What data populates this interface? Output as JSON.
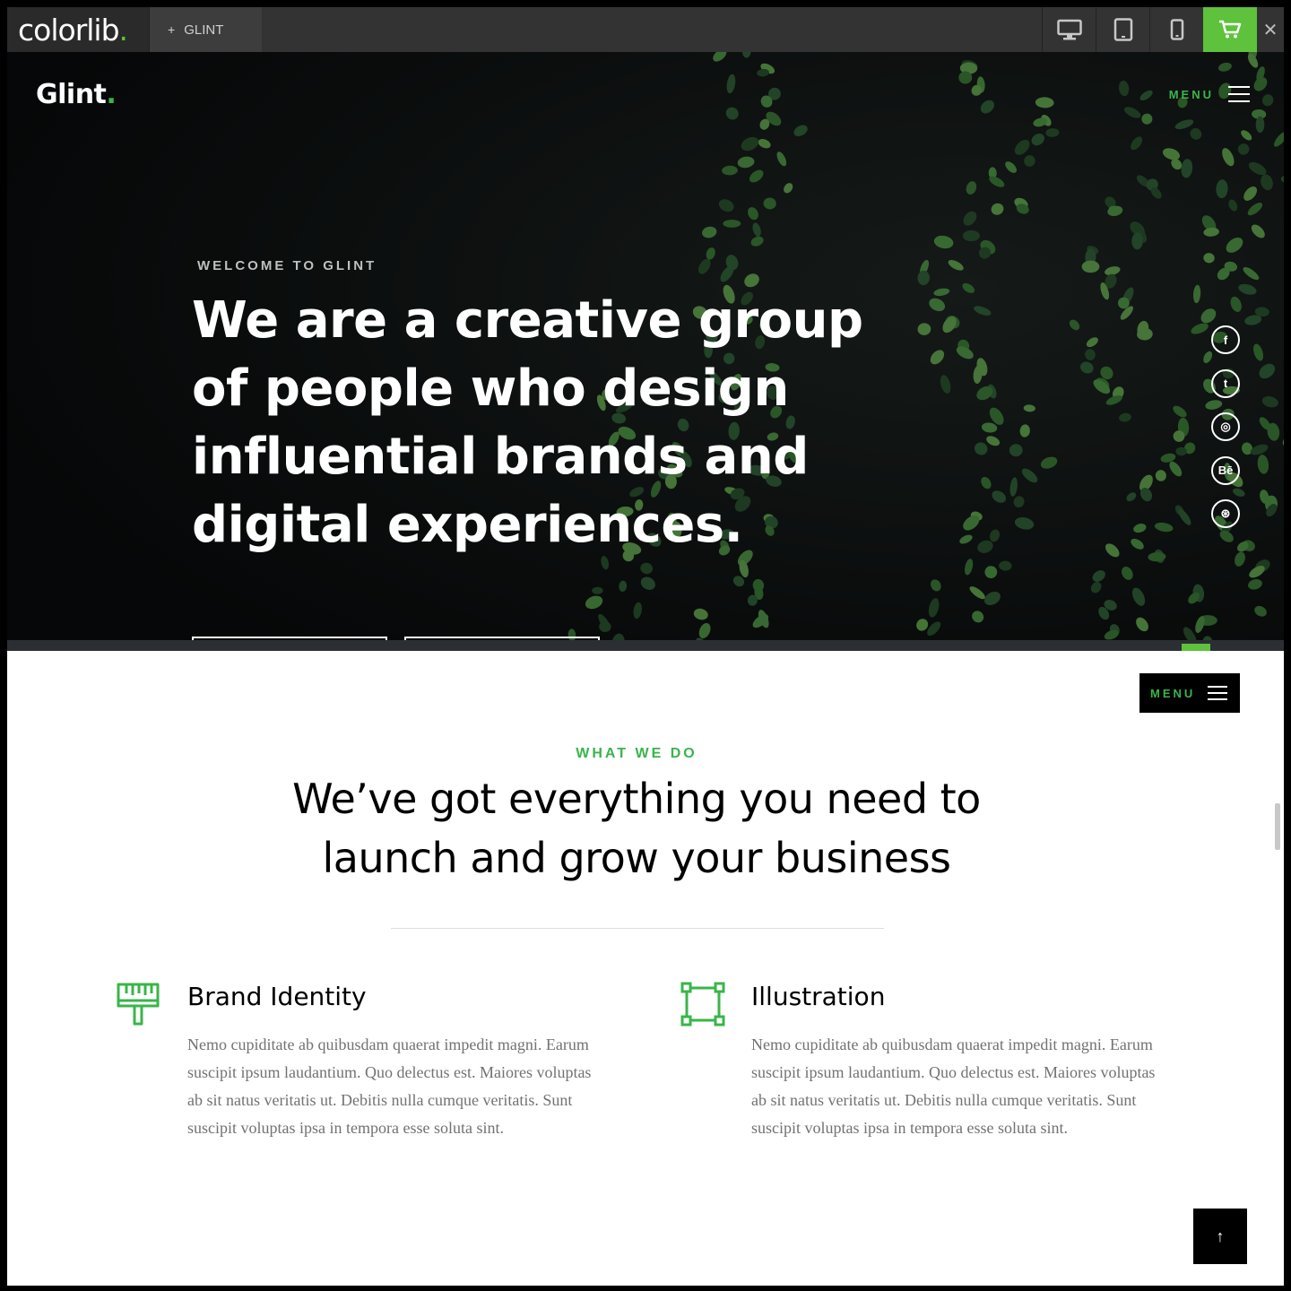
{
  "topbar": {
    "brand": "colorlib",
    "brand_dot": ".",
    "template_tab": "GLINT",
    "template_plus": "+",
    "devices": [
      "desktop-icon",
      "tablet-icon",
      "mobile-icon"
    ],
    "cart_icon": "cart-icon",
    "close_icon": "close-icon",
    "close_glyph": "✕",
    "accent": "#5ec23c"
  },
  "hero": {
    "logo": "Glint",
    "logo_dot": ".",
    "menu_label": "MENU",
    "welcome": "WELCOME TO GLINT",
    "headline_lines": [
      "We are a creative group",
      "of people who design",
      "influential brands and",
      "digital experiences."
    ],
    "social": [
      {
        "icon": "facebook-icon",
        "glyph": "f"
      },
      {
        "icon": "twitter-icon",
        "glyph": "t"
      },
      {
        "icon": "instagram-icon",
        "glyph": "◎"
      },
      {
        "icon": "behance-icon",
        "glyph": "Bē"
      },
      {
        "icon": "dribbble-icon",
        "glyph": "⊛"
      }
    ],
    "accent": "#39b54a"
  },
  "services": {
    "menu_label": "MENU",
    "eyebrow": "WHAT WE DO",
    "title_lines": [
      "We’ve got everything you need to",
      "launch and grow your business"
    ],
    "items": [
      {
        "icon": "paint-brush-icon",
        "title": "Brand Identity",
        "text": "Nemo cupiditate ab quibusdam quaerat impedit magni. Earum suscipit ipsum laudantium. Quo delectus est. Maiores voluptas ab sit natus veritatis ut. Debitis nulla cumque veritatis. Sunt suscipit voluptas ipsa in tempora esse soluta sint."
      },
      {
        "icon": "vector-square-icon",
        "title": "Illustration",
        "text": "Nemo cupiditate ab quibusdam quaerat impedit magni. Earum suscipit ipsum laudantium. Quo delectus est. Maiores voluptas ab sit natus veritatis ut. Debitis nulla cumque veritatis. Sunt suscipit voluptas ipsa in tempora esse soluta sint."
      }
    ],
    "to_top_glyph": "↑"
  }
}
